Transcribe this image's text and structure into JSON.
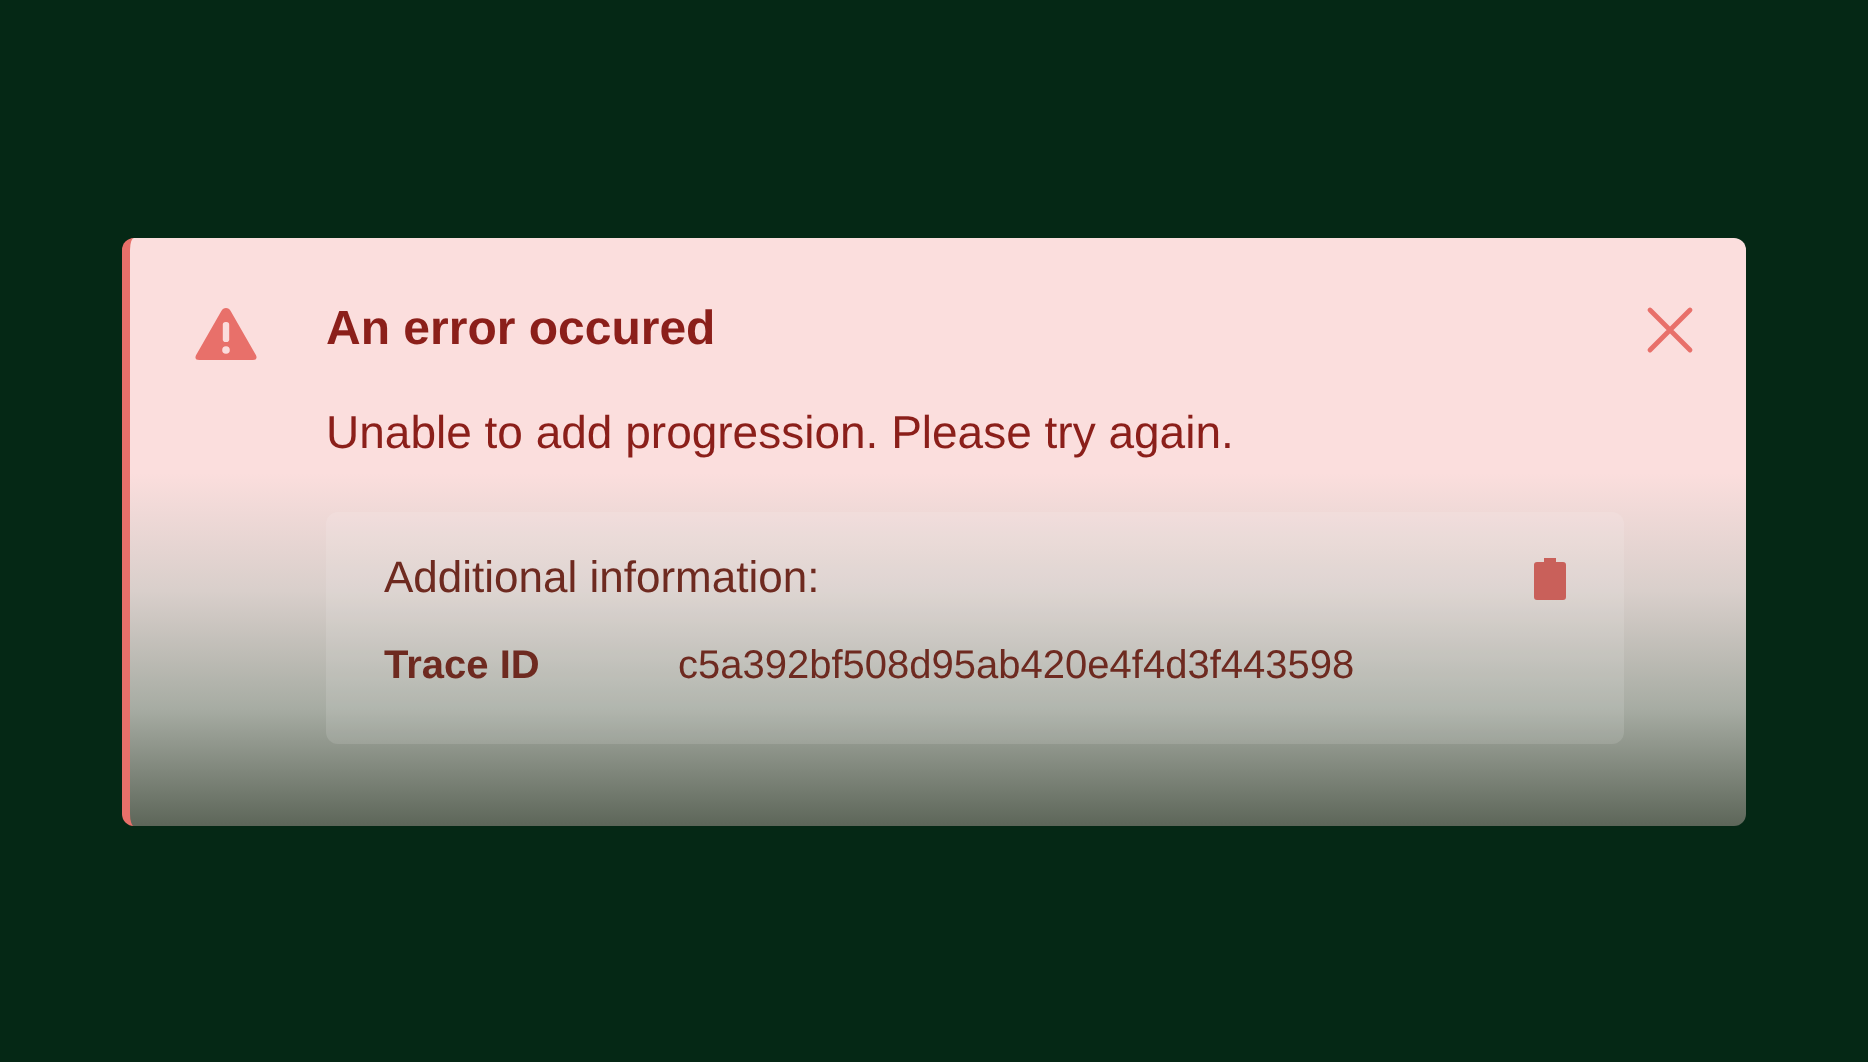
{
  "alert": {
    "title": "An error occured",
    "message": "Unable to add progression. Please try again.",
    "details": {
      "heading": "Additional information:",
      "fields": [
        {
          "label": "Trace ID",
          "value": "c5a392bf508d95ab420e4f4d3f443598"
        }
      ]
    }
  }
}
